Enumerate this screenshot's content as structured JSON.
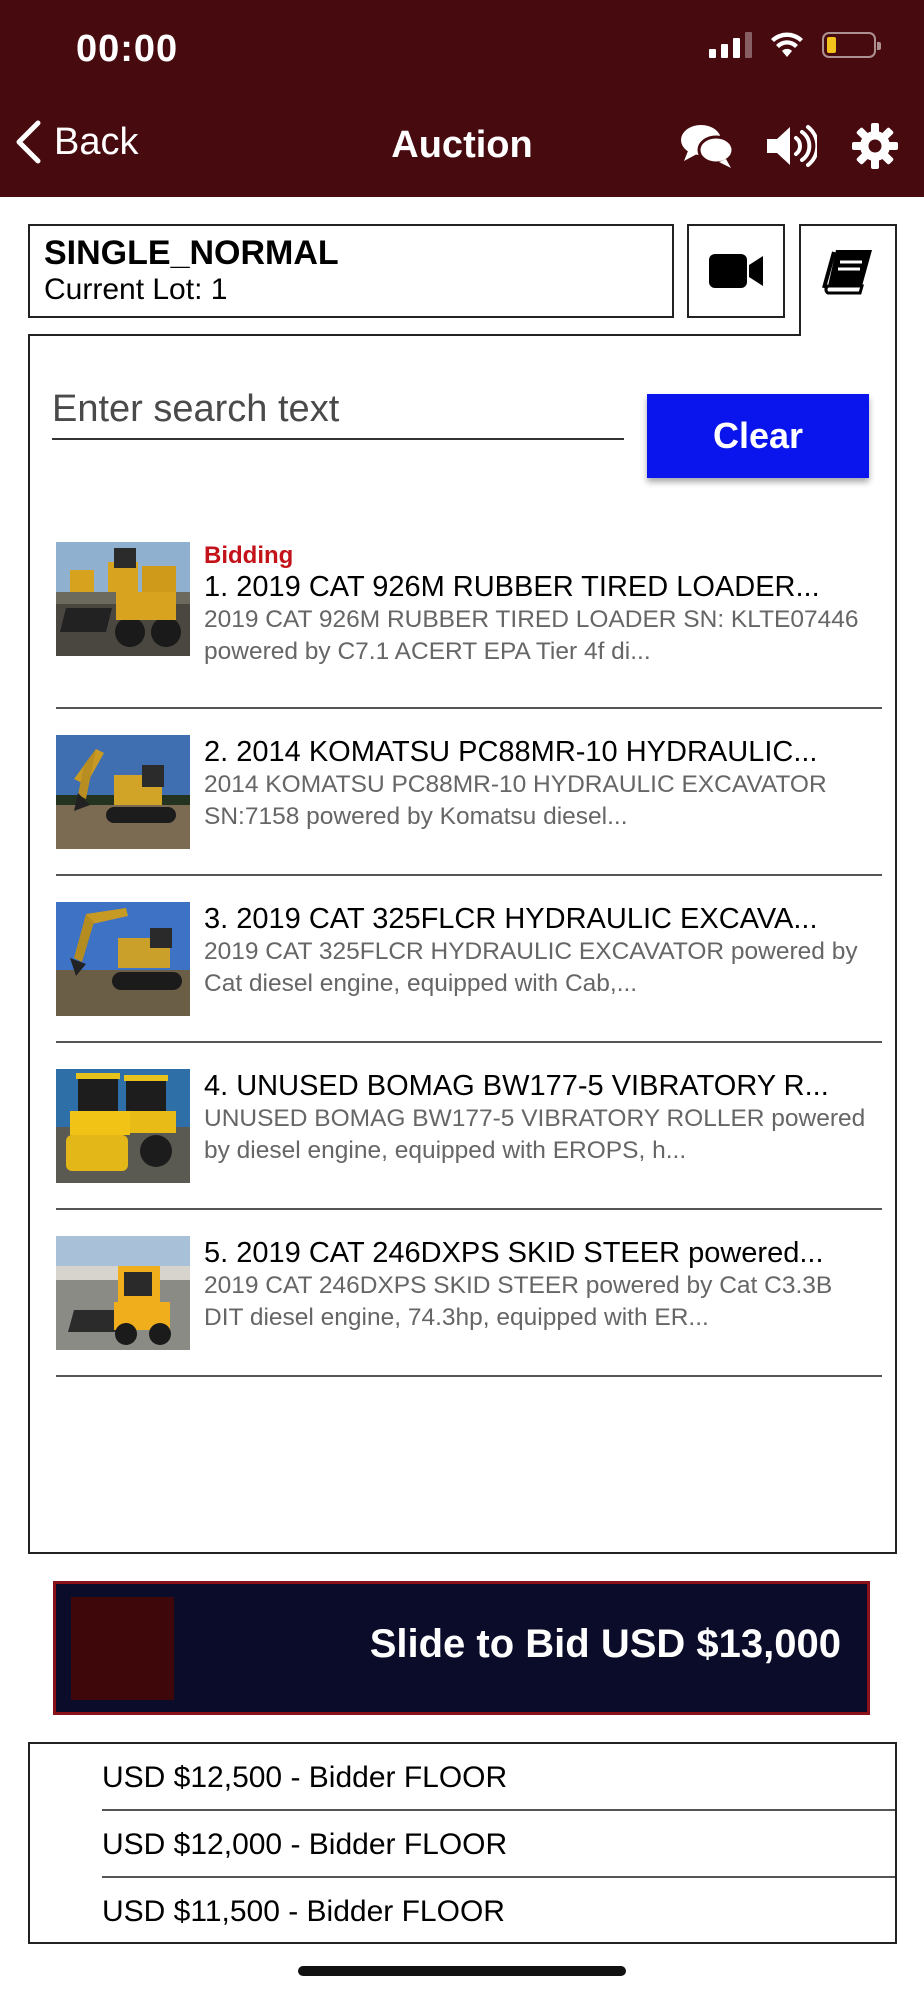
{
  "status_bar": {
    "time": "00:00",
    "icons": [
      "cellular-signal-icon",
      "wifi-icon",
      "battery-low-icon"
    ]
  },
  "nav": {
    "back_label": "Back",
    "title": "Auction",
    "actions": [
      "chat-bubbles-icon",
      "speaker-volume-icon",
      "gear-icon"
    ]
  },
  "auction": {
    "name": "SINGLE_NORMAL",
    "current_lot": "Current Lot: 1",
    "tabs": [
      "video-camera-icon",
      "catalog-book-icon"
    ]
  },
  "search": {
    "placeholder": "Enter search text",
    "value": "",
    "clear_label": "Clear"
  },
  "lots": [
    {
      "status": "Bidding",
      "title": "1. 2019 CAT 926M RUBBER TIRED LOADER...",
      "description": "2019 CAT 926M RUBBER TIRED LOADER SN: KLTE07446 powered by C7.1 ACERT EPA Tier 4f di...",
      "thumb": "wheel-loader-photo"
    },
    {
      "status": "",
      "title": "2. 2014 KOMATSU PC88MR-10 HYDRAULIC...",
      "description": "2014 KOMATSU PC88MR-10 HYDRAULIC EXCAVATOR SN:7158 powered by Komatsu diesel...",
      "thumb": "excavator-photo"
    },
    {
      "status": "",
      "title": "3. 2019 CAT 325FLCR HYDRAULIC EXCAVA...",
      "description": "2019 CAT 325FLCR HYDRAULIC EXCAVATOR powered by Cat diesel engine, equipped with Cab,...",
      "thumb": "excavator-photo"
    },
    {
      "status": "",
      "title": "4. UNUSED BOMAG BW177-5 VIBRATORY R...",
      "description": "UNUSED BOMAG BW177-5 VIBRATORY ROLLER powered by diesel engine, equipped with EROPS, h...",
      "thumb": "vibratory-roller-photo"
    },
    {
      "status": "",
      "title": "5. 2019 CAT 246DXPS SKID STEER powered...",
      "description": "2019 CAT 246DXPS SKID STEER powered by Cat C3.3B DIT diesel engine, 74.3hp, equipped with ER...",
      "thumb": "skid-steer-photo"
    }
  ],
  "slider": {
    "label": "Slide to Bid USD $13,000"
  },
  "bid_history": [
    "USD $12,500 - Bidder FLOOR",
    "USD $12,000 - Bidder FLOOR",
    "USD $11,500 - Bidder FLOOR"
  ],
  "colors": {
    "header_bg": "#470a0e",
    "clear_button": "#0a14ec",
    "bidding_status": "#c4121a",
    "slider_bg": "#0b0c2a",
    "slider_border": "#8a1119",
    "slider_knob": "#3e070a"
  }
}
